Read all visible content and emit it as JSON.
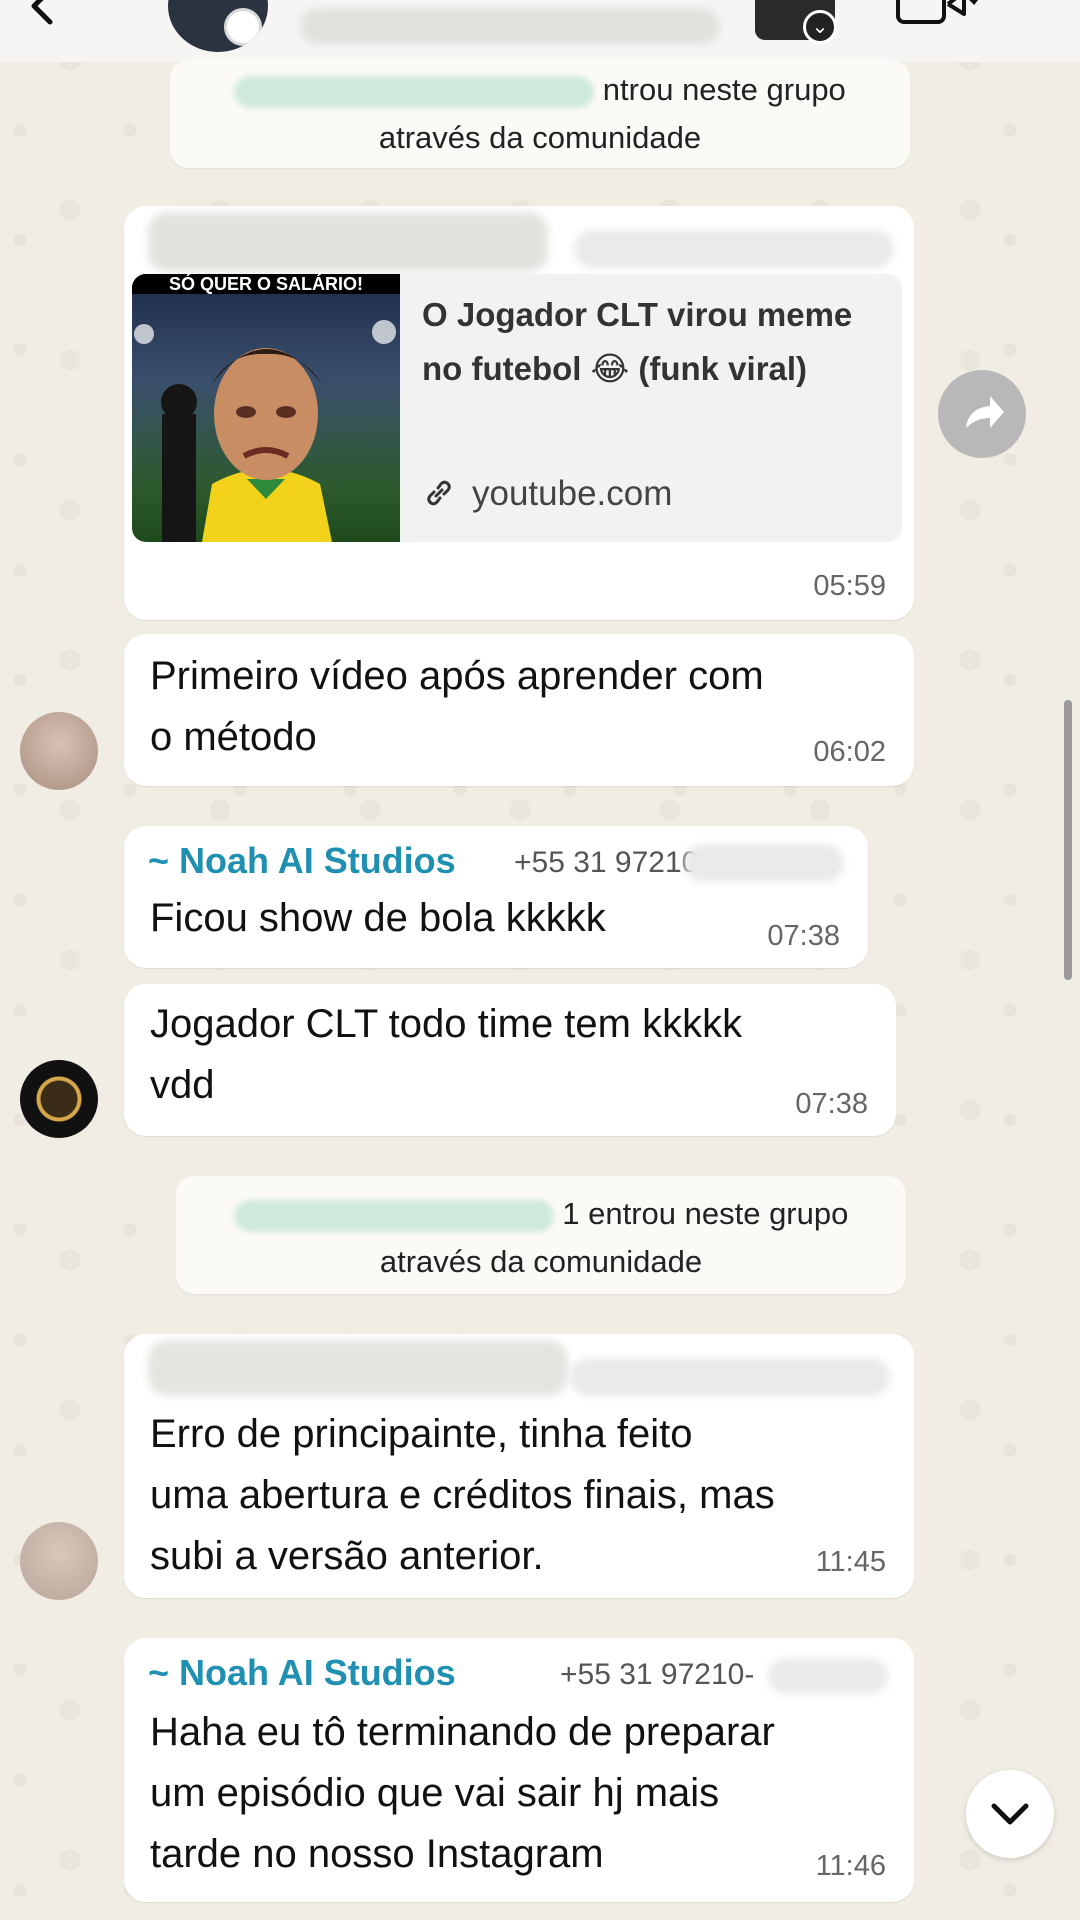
{
  "header": {
    "back_icon": "chevron-left-icon",
    "video_icon": "video-call-icon"
  },
  "system_messages": [
    {
      "suffix": "ntrou neste grupo",
      "line2": "através da comunidade"
    },
    {
      "suffix": "1 entrou neste grupo",
      "line2": "através da comunidade"
    }
  ],
  "link_message": {
    "title": "O Jogador CLT virou meme no futebol 😂 (funk viral)",
    "domain": "youtube.com",
    "thumb_caption": "SÓ QUER O SALÁRIO!",
    "time": "05:59"
  },
  "messages": [
    {
      "text_line1": "Primeiro vídeo após aprender com",
      "text_line2": "o método",
      "time": "06:02"
    },
    {
      "sender": "~ Noah AI Studios",
      "phone": "+55 31 97210",
      "text": "Ficou show de bola kkkkk",
      "time": "07:38"
    },
    {
      "text_line1": "Jogador CLT todo time tem kkkkk",
      "text_line2": "vdd",
      "time": "07:38"
    },
    {
      "text_line1": "Erro de principainte, tinha feito",
      "text_line2": "uma abertura e créditos finais, mas",
      "text_line3": "subi a versão anterior.",
      "time": "11:45"
    },
    {
      "sender": "~ Noah AI Studios",
      "phone": "+55 31 97210-",
      "text_line1": "Haha eu tô terminando de preparar",
      "text_line2": "um episódio que vai sair hj mais",
      "text_line3": "tarde no nosso Instagram",
      "time": "11:46"
    }
  ],
  "colors": {
    "sender": "#1f8fb2",
    "bubble": "#ffffff",
    "background": "#efeae2"
  }
}
